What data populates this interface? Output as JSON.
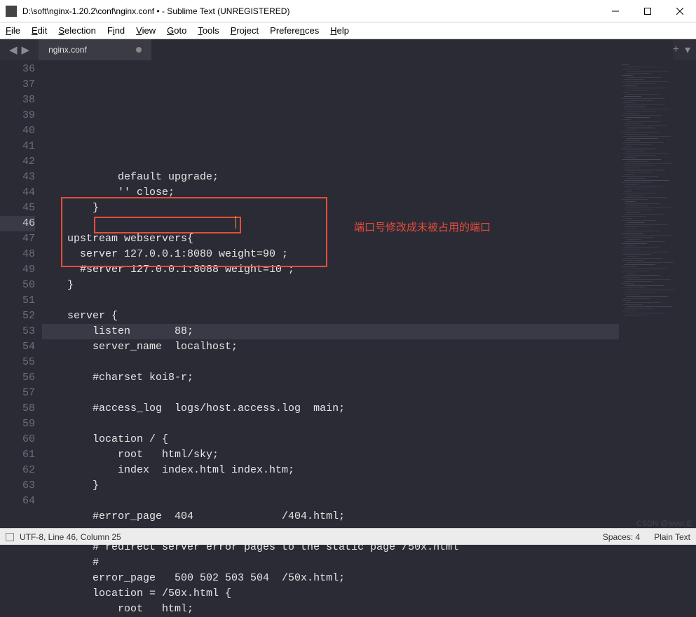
{
  "window": {
    "title": "D:\\soft\\nginx-1.20.2\\conf\\nginx.conf • - Sublime Text (UNREGISTERED)"
  },
  "menu": {
    "items": [
      {
        "label": "File",
        "mn": "F"
      },
      {
        "label": "Edit",
        "mn": "E"
      },
      {
        "label": "Selection",
        "mn": "S"
      },
      {
        "label": "Find",
        "mn": "i"
      },
      {
        "label": "View",
        "mn": "V"
      },
      {
        "label": "Goto",
        "mn": "G"
      },
      {
        "label": "Tools",
        "mn": "T"
      },
      {
        "label": "Project",
        "mn": "P"
      },
      {
        "label": "Preferences",
        "mn": "n"
      },
      {
        "label": "Help",
        "mn": "H"
      }
    ]
  },
  "tabs": {
    "active": {
      "label": "nginx.conf",
      "dirty": true
    }
  },
  "annotation": {
    "text": "端口号修改成未被占用的端口"
  },
  "code_lines": [
    {
      "n": 36,
      "t": "            default upgrade;"
    },
    {
      "n": 37,
      "t": "            '' close;"
    },
    {
      "n": 38,
      "t": "        }"
    },
    {
      "n": 39,
      "t": ""
    },
    {
      "n": 40,
      "t": "    upstream webservers{"
    },
    {
      "n": 41,
      "t": "      server 127.0.0.1:8080 weight=90 ;"
    },
    {
      "n": 42,
      "t": "      #server 127.0.0.1:8088 weight=10 ;"
    },
    {
      "n": 43,
      "t": "    }"
    },
    {
      "n": 44,
      "t": ""
    },
    {
      "n": 45,
      "t": "    server {"
    },
    {
      "n": 46,
      "t": "        listen       88;"
    },
    {
      "n": 47,
      "t": "        server_name  localhost;"
    },
    {
      "n": 48,
      "t": ""
    },
    {
      "n": 49,
      "t": "        #charset koi8-r;"
    },
    {
      "n": 50,
      "t": ""
    },
    {
      "n": 51,
      "t": "        #access_log  logs/host.access.log  main;"
    },
    {
      "n": 52,
      "t": ""
    },
    {
      "n": 53,
      "t": "        location / {"
    },
    {
      "n": 54,
      "t": "            root   html/sky;"
    },
    {
      "n": 55,
      "t": "            index  index.html index.htm;"
    },
    {
      "n": 56,
      "t": "        }"
    },
    {
      "n": 57,
      "t": ""
    },
    {
      "n": 58,
      "t": "        #error_page  404              /404.html;"
    },
    {
      "n": 59,
      "t": ""
    },
    {
      "n": 60,
      "t": "        # redirect server error pages to the static page /50x.html"
    },
    {
      "n": 61,
      "t": "        #"
    },
    {
      "n": 62,
      "t": "        error_page   500 502 503 504  /50x.html;"
    },
    {
      "n": 63,
      "t": "        location = /50x.html {"
    },
    {
      "n": 64,
      "t": "            root   html;"
    }
  ],
  "status": {
    "encoding_line_col": "UTF-8, Line 46, Column 25",
    "spaces": "Spaces: 4",
    "syntax": "Plain Text"
  },
  "watermark": "CSDN @lever.E"
}
